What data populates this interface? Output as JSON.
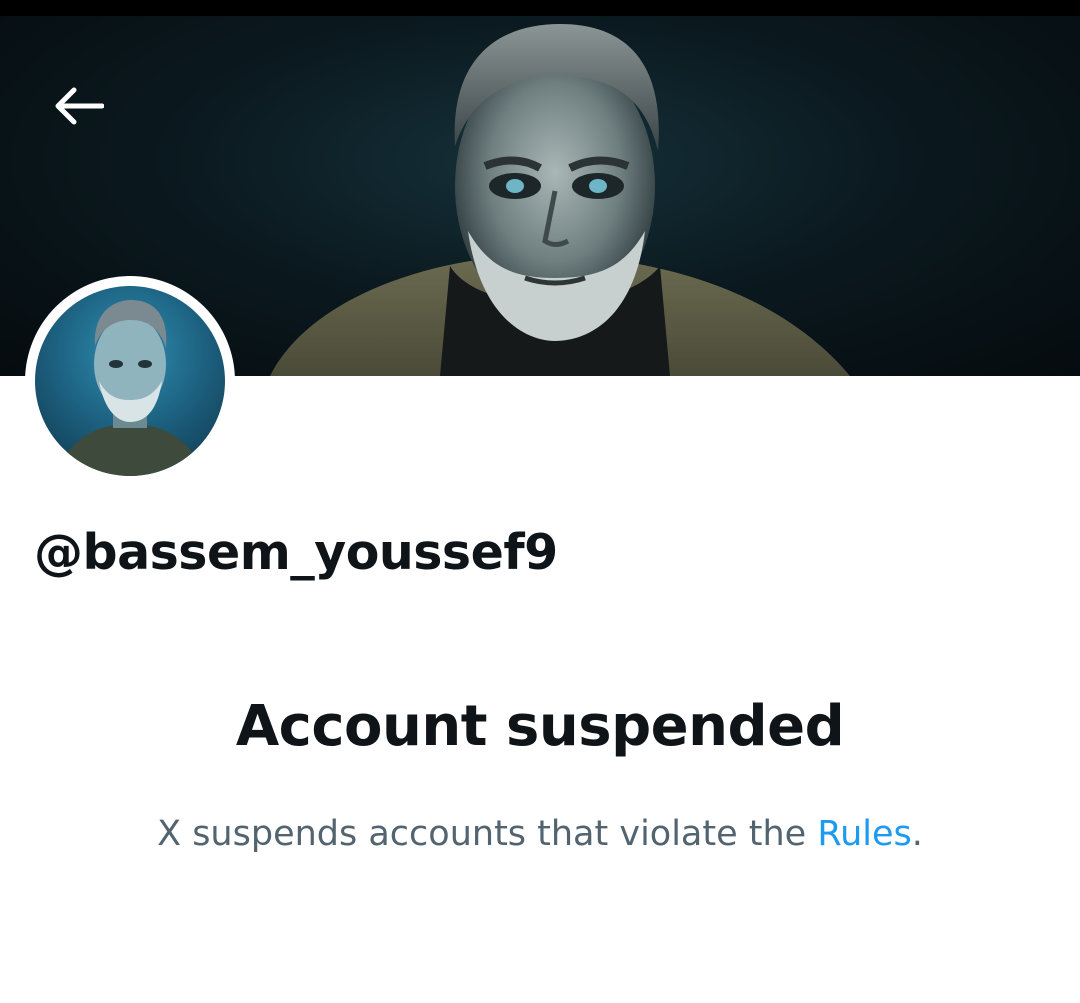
{
  "profile": {
    "handle": "@bassem_youssef9",
    "banner_icon": "banner-image",
    "avatar_icon": "avatar-image"
  },
  "header": {
    "back_icon": "arrow-left-icon"
  },
  "notice": {
    "title": "Account suspended",
    "text_before": "X suspends accounts that violate the ",
    "link_label": "Rules",
    "text_after": "."
  },
  "colors": {
    "text_primary": "#0f1419",
    "text_secondary": "#536471",
    "link": "#1d9bf0"
  }
}
